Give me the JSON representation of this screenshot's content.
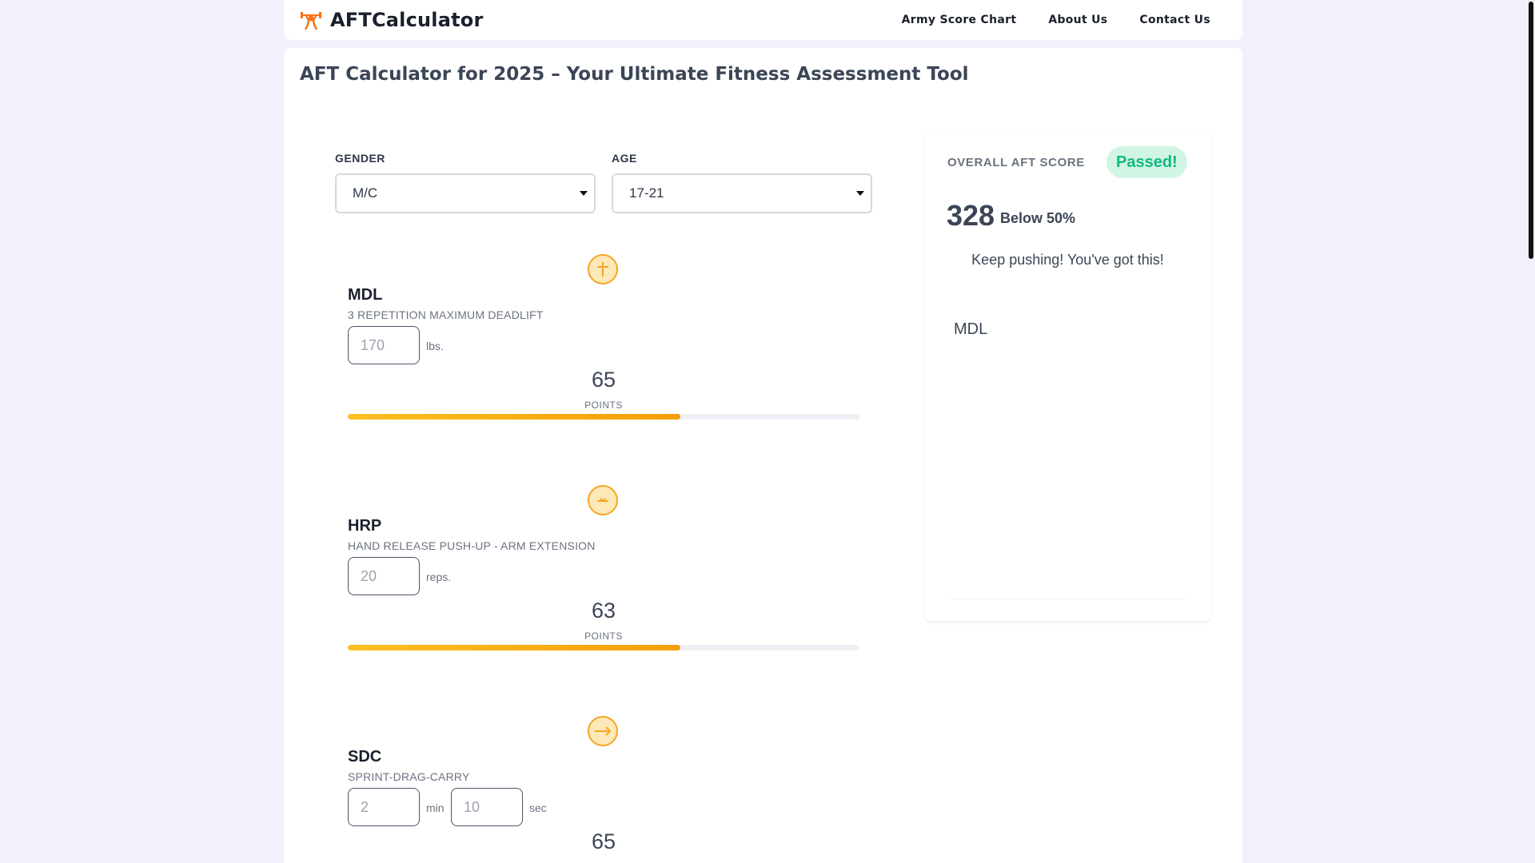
{
  "header": {
    "brand": "AFTCalculator",
    "nav": [
      "Army Score Chart",
      "About Us",
      "Contact Us"
    ]
  },
  "main": {
    "title": "AFT Calculator for 2025 – Your Ultimate Fitness Assessment Tool",
    "gender": {
      "label": "GENDER",
      "value": "M/C"
    },
    "age": {
      "label": "AGE",
      "value": "17-21"
    }
  },
  "events": [
    {
      "code": "MDL",
      "name": "3 REPETITION MAXIMUM DEADLIFT",
      "inputs": [
        {
          "placeholder": "170",
          "unit": "lbs."
        }
      ],
      "points": "65",
      "points_label": "POINTS",
      "progress": 0.65,
      "icon": "deadlift-icon"
    },
    {
      "code": "HRP",
      "name": "HAND RELEASE PUSH-UP - ARM EXTENSION",
      "inputs": [
        {
          "placeholder": "20",
          "unit": "reps."
        }
      ],
      "points": "63",
      "points_label": "POINTS",
      "progress": 0.65,
      "icon": "pushup-icon"
    },
    {
      "code": "SDC",
      "name": "SPRINT-DRAG-CARRY",
      "inputs": [
        {
          "placeholder": "2",
          "unit": "min"
        },
        {
          "placeholder": "10",
          "unit": "sec"
        }
      ],
      "points": "65",
      "icon": "sprint-arrow-icon"
    }
  ],
  "score": {
    "label": "OVERALL AFT SCORE",
    "status": "Passed!",
    "total": "328",
    "percentile": "Below 50%",
    "message": "Keep pushing! You've got this!",
    "chart_label": "MDL"
  },
  "colors": {
    "accent": "#f5a623",
    "bar_start": "#fbbf24",
    "bar_end": "#f59e0b",
    "pass_bg": "#d1f5e4",
    "pass_text": "#10b981",
    "page_bg": "#f0f1fa"
  }
}
